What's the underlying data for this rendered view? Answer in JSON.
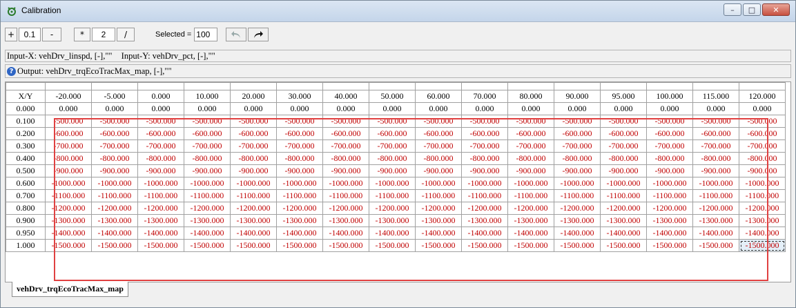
{
  "window": {
    "title": "Calibration",
    "icon": "calibration-icon",
    "buttons": {
      "minimize": "–",
      "maximize": "□",
      "close": "✕"
    }
  },
  "toolbar": {
    "plus_label": "+",
    "step_add": "0.1",
    "minus_label": "-",
    "times_label": "*",
    "step_mul": "2",
    "divide_label": "/",
    "selected_label": "Selected =",
    "selected_value": "100",
    "undo_icon": "undo-arrow-icon",
    "redo_icon": "redo-arrow-icon"
  },
  "inputs": {
    "x": "Input-X: vehDrv_linspd, [-],\"\"",
    "y": "Input-Y: vehDrv_pct, [-],\"\""
  },
  "output": {
    "text": "Output: vehDrv_trqEcoTracMax_map, [-],\"\"",
    "icon": "help-icon"
  },
  "table": {
    "corner": "X/Y",
    "columns": [
      "-20.000",
      "-5.000",
      "0.000",
      "10.000",
      "20.000",
      "30.000",
      "40.000",
      "50.000",
      "60.000",
      "70.000",
      "80.000",
      "90.000",
      "95.000",
      "100.000",
      "115.000",
      "120.000"
    ],
    "rows": [
      {
        "y": "0.000",
        "value": "0.000"
      },
      {
        "y": "0.100",
        "value": "-500.000"
      },
      {
        "y": "0.200",
        "value": "-600.000"
      },
      {
        "y": "0.300",
        "value": "-700.000"
      },
      {
        "y": "0.400",
        "value": "-800.000"
      },
      {
        "y": "0.500",
        "value": "-900.000"
      },
      {
        "y": "0.600",
        "value": "-1000.000"
      },
      {
        "y": "0.700",
        "value": "-1100.000"
      },
      {
        "y": "0.800",
        "value": "-1200.000"
      },
      {
        "y": "0.900",
        "value": "-1300.000"
      },
      {
        "y": "0.950",
        "value": "-1400.000"
      },
      {
        "y": "1.000",
        "value": "-1500.000"
      }
    ],
    "value_color": "#c00000",
    "highlight_color": "#e04040"
  },
  "tabs": [
    {
      "label": "vehDrv_trqEcoTracMax_map"
    }
  ]
}
